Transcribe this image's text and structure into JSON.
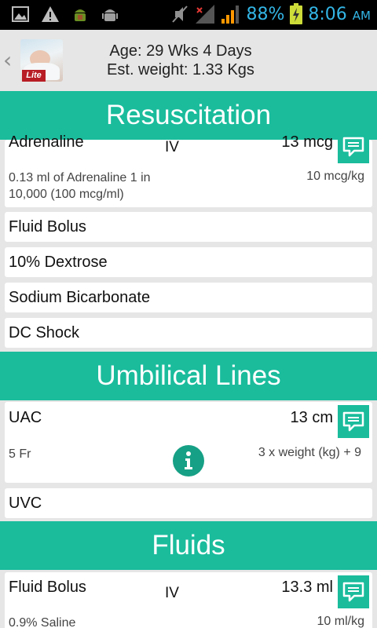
{
  "colors": {
    "accent": "#1abc9c",
    "status_bar": "#000000",
    "status_text": "#33b5e5",
    "lite_badge": "#b81d25"
  },
  "status_bar": {
    "left_icons": [
      "gallery-icon",
      "warning-icon",
      "android-debug-icon",
      "android-usb-icon"
    ],
    "right_icons": [
      "mute-icon",
      "no-signal-icon",
      "signal-bars-icon",
      "battery-charging-icon"
    ],
    "battery_percent": "88%",
    "time": "8:06",
    "ampm": "AM"
  },
  "header": {
    "back_icon": "chevron-left-icon",
    "logo_badge": "Lite",
    "age": "Age: 29 Wks 4 Days",
    "weight": "Est. weight: 1.33 Kgs"
  },
  "sections": [
    {
      "title": "Resuscitation",
      "cards": [
        {
          "name": "Adrenaline",
          "route": "IV",
          "dose": "13 mcg",
          "detail": "0.13 ml of Adrenaline 1 in 10,000 (100 mcg/ml)",
          "rate": "10 mcg/kg"
        },
        {
          "name": "Fluid Bolus"
        },
        {
          "name": "10% Dextrose"
        },
        {
          "name": "Sodium Bicarbonate"
        },
        {
          "name": "DC Shock"
        }
      ]
    },
    {
      "title": "Umbilical Lines",
      "cards": [
        {
          "name": "UAC",
          "dose": "13 cm",
          "detail": "5 Fr",
          "formula": "3 x weight (kg) + 9"
        },
        {
          "name": "UVC"
        }
      ]
    },
    {
      "title": "Fluids",
      "cards": [
        {
          "name": "Fluid Bolus",
          "route": "IV",
          "dose": "13.3 ml",
          "detail": "0.9% Saline",
          "rate": "10 ml/kg"
        }
      ]
    }
  ]
}
